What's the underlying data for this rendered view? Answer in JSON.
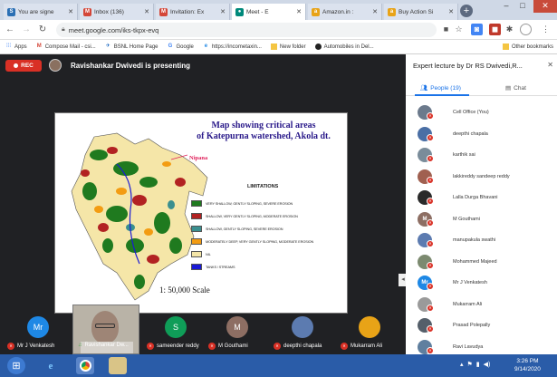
{
  "browser": {
    "tabs": [
      {
        "label": "You are signe",
        "fav": "S",
        "color": "#2a6fb4",
        "active": false
      },
      {
        "label": "Inbox (136)",
        "fav": "M",
        "color": "#d44638",
        "active": false
      },
      {
        "label": "Invitation: Ex",
        "fav": "M",
        "color": "#d44638",
        "active": false
      },
      {
        "label": "Meet - E",
        "fav": "●",
        "color": "#00897b",
        "active": true
      },
      {
        "label": "Amazon.in :",
        "fav": "a",
        "color": "#e8a317",
        "active": false
      },
      {
        "label": "Buy Action Si",
        "fav": "a",
        "color": "#e8a317",
        "active": false
      }
    ],
    "url": "meet.google.com/iks-tkpx-evq",
    "bookmarks": [
      {
        "label": "Apps",
        "icon": "apps-icon"
      },
      {
        "label": "Compose Mail - csi...",
        "icon": "gmail-icon"
      },
      {
        "label": "BSNL Home Page",
        "icon": "bsnl-icon"
      },
      {
        "label": "Google",
        "icon": "google-icon"
      },
      {
        "label": "https://incometaxin...",
        "icon": "ie-icon"
      },
      {
        "label": "New folder",
        "icon": "folder-icon"
      },
      {
        "label": "Automobiles in Del...",
        "icon": "globe-icon"
      }
    ],
    "other_bookmarks": "Other bookmarks"
  },
  "meet": {
    "rec_label": "REC",
    "presenting_text": "Ravishankar Dwivedi is presenting",
    "panel_title": "Expert lecture by Dr RS Dwivedi,R...",
    "people_tab": "People (19)",
    "chat_tab": "Chat",
    "participants": [
      {
        "name": "Cell Office (You)",
        "initial": "",
        "color": "#6c7a8c"
      },
      {
        "name": "deepthi chapala",
        "initial": "",
        "color": "#4a6fa5"
      },
      {
        "name": "karthik sai",
        "initial": "",
        "color": "#7a8c9a"
      },
      {
        "name": "lakkireddy sandeep reddy",
        "initial": "",
        "color": "#a06050"
      },
      {
        "name": "Lalla Durga Bhavani",
        "initial": "",
        "color": "#2a2a2a"
      },
      {
        "name": "M Gouthami",
        "initial": "M",
        "color": "#8d6e63"
      },
      {
        "name": "manupakula swathi",
        "initial": "",
        "color": "#5c7bb0"
      },
      {
        "name": "Mohammed Majeed",
        "initial": "",
        "color": "#7c8a70"
      },
      {
        "name": "Mr J Venkatesh",
        "initial": "Mr",
        "color": "#1e88e5"
      },
      {
        "name": "Mukarram Ali",
        "initial": "",
        "color": "#9a9a9a"
      },
      {
        "name": "Prasad Polepally",
        "initial": "",
        "color": "#555f6a"
      },
      {
        "name": "Ravi Lavudya",
        "initial": "",
        "color": "#5f7f9f"
      }
    ],
    "tiles": [
      {
        "name": "Mr J Venkatesh",
        "initial": "Mr",
        "color": "#1e88e5"
      },
      {
        "name": "Ravishankar Dw...",
        "initial": "",
        "color": ""
      },
      {
        "name": "sameender reddy",
        "initial": "S",
        "color": "#0f9d58"
      },
      {
        "name": "M Gouthami",
        "initial": "M",
        "color": "#8d6e63"
      },
      {
        "name": "deepthi chapala",
        "initial": "",
        "color": "#5c7bb0"
      },
      {
        "name": "Mukarram Ali",
        "initial": "",
        "color": "#e8a317"
      }
    ]
  },
  "slide": {
    "title_line1": "Map showing critical areas",
    "title_line2": "of Katepurna watershed, Akola dt.",
    "place_label": "Nipana",
    "legend_title": "LIMITATIONS",
    "legend": [
      {
        "label": "VERY SHALLOW, GENTLY SLOPING, SEVERE EROSION",
        "color": "#1f7a1f"
      },
      {
        "label": "SHALLOW, VERY GENTLY SLOPING, MODERATE EROSION",
        "color": "#b22222"
      },
      {
        "label": "SHALLOW, GENTLY SLOPING, SEVERE EROSION",
        "color": "#3a8f8f"
      },
      {
        "label": "MODERATELY DEEP, VERY GENTLY SLOPING, MODERATE EROSION",
        "color": "#f39c12"
      },
      {
        "label": "NIL",
        "color": "#f5e6a8"
      },
      {
        "label": "TANKS / STREAMS",
        "color": "#1a1ad6"
      }
    ],
    "scale": "1: 50,000 Scale"
  },
  "taskbar": {
    "time": "3:26 PM",
    "date": "9/14/2020"
  }
}
